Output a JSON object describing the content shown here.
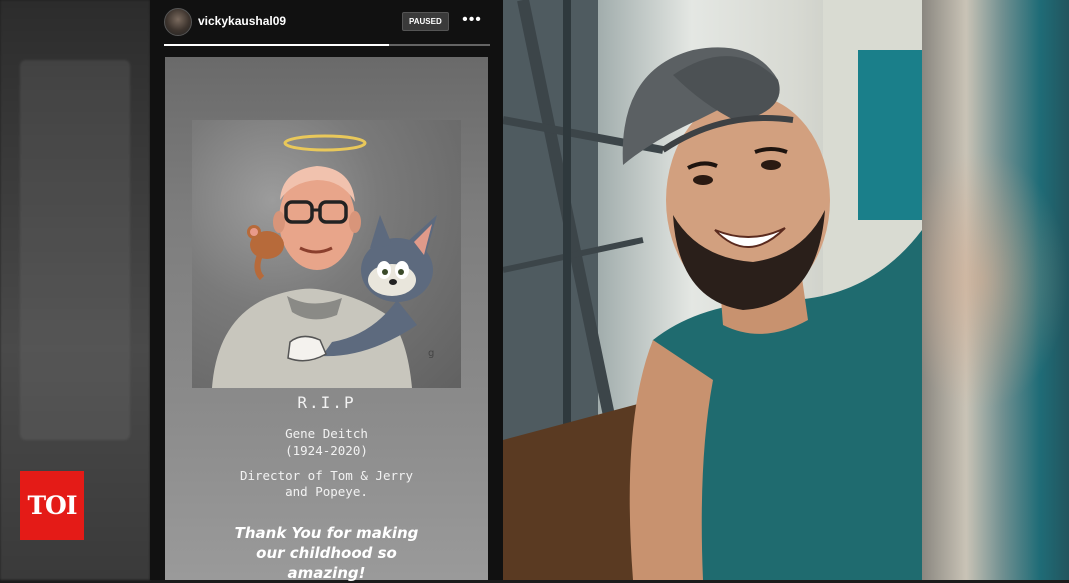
{
  "story": {
    "username": "vickykaushal09",
    "status_badge": "PAUSED",
    "more_options_label": "•••",
    "progress_fraction": 0.69,
    "text": {
      "title": "R.I.P",
      "name": "Gene Deitch",
      "years": "(1924-2020)",
      "description": "Director of Tom & Jerry\nand Popeye.",
      "thanks": "Thank You for making\nour childhood so\namazing!"
    },
    "artwork_signature": "g"
  },
  "branding": {
    "logo_text": "TOI",
    "logo_color": "#e41b17"
  },
  "icons": [
    "avatar",
    "more-options-icon",
    "halo-icon"
  ]
}
